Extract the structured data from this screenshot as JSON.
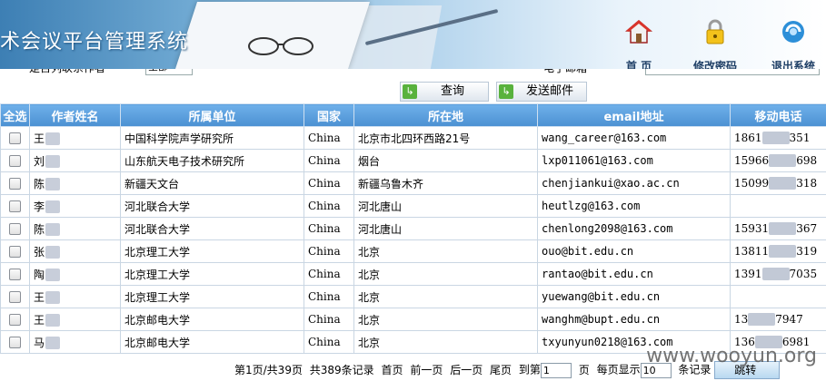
{
  "header": {
    "title": "术会议平台管理系统",
    "buttons": [
      {
        "label": "首  页",
        "icon": "home-icon"
      },
      {
        "label": "修改密码",
        "icon": "lock-icon"
      },
      {
        "label": "退出系统",
        "icon": "exit-icon"
      }
    ]
  },
  "filter": {
    "contact_label": "是否列联系作者",
    "contact_select": "全部",
    "email_label": "电子邮箱",
    "email_value": ""
  },
  "actions": {
    "query_label": "查询",
    "send_mail_label": "发送邮件"
  },
  "table": {
    "headers": [
      "全选",
      "作者姓名",
      "所属单位",
      "国家",
      "所在地",
      "email地址",
      "移动电话"
    ],
    "rows": [
      {
        "name": "王",
        "name_end": "",
        "unit": "中国科学院声学研究所",
        "country": "China",
        "location": "北京市北四环西路21号",
        "email": "wang_career@163.com",
        "phone_start": "1861",
        "phone_end": "351"
      },
      {
        "name": "刘",
        "name_end": "",
        "unit": "山东航天电子技术研究所",
        "country": "China",
        "location": "烟台",
        "email": "lxp011061@163.com",
        "phone_start": "15966",
        "phone_end": "698"
      },
      {
        "name": "陈",
        "name_end": "",
        "unit": "新疆天文台",
        "country": "China",
        "location": "新疆乌鲁木齐",
        "email": "chenjiankui@xao.ac.cn",
        "phone_start": "15099",
        "phone_end": "318"
      },
      {
        "name": "李",
        "name_end": "",
        "unit": "河北联合大学",
        "country": "China",
        "location": "河北唐山",
        "email": "heutlzg@163.com",
        "phone_start": "",
        "phone_end": ""
      },
      {
        "name": "陈",
        "name_end": "",
        "unit": "河北联合大学",
        "country": "China",
        "location": "河北唐山",
        "email": "chenlong2098@163.com",
        "phone_start": "15931",
        "phone_end": "367"
      },
      {
        "name": "张",
        "name_end": "",
        "unit": "北京理工大学",
        "country": "China",
        "location": "北京",
        "email": "ouo@bit.edu.cn",
        "phone_start": "13811",
        "phone_end": "319"
      },
      {
        "name": "陶",
        "name_end": "",
        "unit": "北京理工大学",
        "country": "China",
        "location": "北京",
        "email": "rantao@bit.edu.cn",
        "phone_start": "1391",
        "phone_end": "7035"
      },
      {
        "name": "王",
        "name_end": "",
        "unit": "北京理工大学",
        "country": "China",
        "location": "北京",
        "email": "yuewang@bit.edu.cn",
        "phone_start": "",
        "phone_end": ""
      },
      {
        "name": "王",
        "name_end": "",
        "unit": "北京邮电大学",
        "country": "China",
        "location": "北京",
        "email": "wanghm@bupt.edu.cn",
        "phone_start": "13",
        "phone_end": "7947"
      },
      {
        "name": "马",
        "name_end": "",
        "unit": "北京邮电大学",
        "country": "China",
        "location": "北京",
        "email": "txyunyun0218@163.com",
        "phone_start": "136",
        "phone_end": "6981"
      }
    ]
  },
  "pager": {
    "summary": "第1页/共39页",
    "total": "共389条记录",
    "first": "首页",
    "prev": "前一页",
    "next": "后一页",
    "last": "尾页",
    "goto_prefix": "到第",
    "goto_value": "1",
    "goto_suffix": "页",
    "per_page_prefix": "每页显示",
    "per_page_value": "10",
    "per_page_suffix": "条记录",
    "go_label": "跳转"
  },
  "watermark": "www.wooyun.org"
}
